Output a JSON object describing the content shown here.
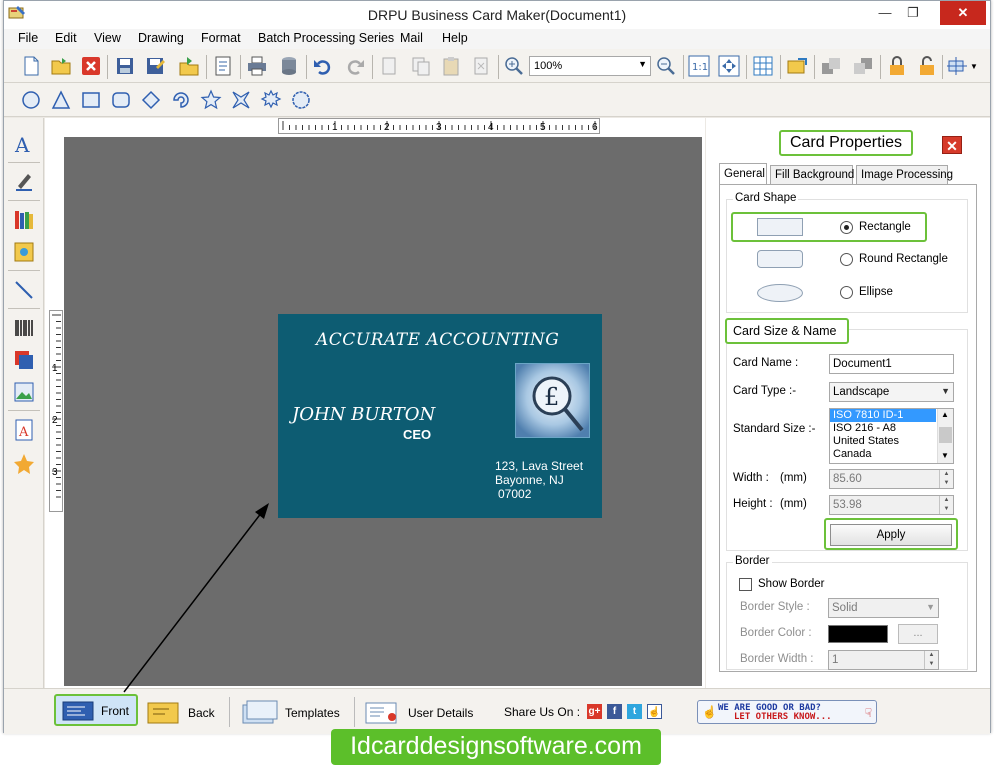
{
  "window": {
    "title": "DRPU Business Card Maker(Document1)"
  },
  "menu": [
    "File",
    "Edit",
    "View",
    "Drawing",
    "Format",
    "Batch Processing Series",
    "Mail",
    "Help"
  ],
  "toolbar": {
    "zoom_value": "100%"
  },
  "ruler": {
    "h_labels": [
      "1",
      "2",
      "3",
      "4",
      "5",
      "6"
    ],
    "v_labels": [
      "1",
      "2",
      "3"
    ]
  },
  "card": {
    "company": "ACCURATE ACCOUNTING",
    "name": "JOHN BURTON",
    "title": "CEO",
    "logo_symbol": "£",
    "address": [
      "123, Lava Street",
      "Bayonne, NJ",
      "07002"
    ],
    "background_color": "#0d5c72"
  },
  "properties": {
    "title": "Card Properties",
    "tabs": [
      "General",
      "Fill Background",
      "Image Processing"
    ],
    "card_shape": {
      "label": "Card Shape",
      "options": [
        "Rectangle",
        "Round Rectangle",
        "Ellipse"
      ],
      "selected": "Rectangle"
    },
    "card_size": {
      "label": "Card Size & Name",
      "card_name_label": "Card Name :",
      "card_name_value": "Document1",
      "card_type_label": "Card Type :-",
      "card_type_value": "Landscape",
      "standard_size_label": "Standard Size :-",
      "standard_sizes": [
        "ISO 7810 ID-1",
        "ISO 216 - A8",
        "United States",
        "Canada"
      ],
      "selected_size": "ISO 7810 ID-1",
      "width_label": "Width :",
      "height_label": "Height :",
      "unit": "(mm)",
      "width_value": "85.60",
      "height_value": "53.98",
      "apply_label": "Apply"
    },
    "border": {
      "label": "Border",
      "show_border_label": "Show Border",
      "style_label": "Border Style :",
      "style_value": "Solid",
      "color_label": "Border Color :",
      "color_value": "#000000",
      "color_button": "...",
      "width_label": "Border Width :",
      "width_value": "1"
    }
  },
  "bottombar": {
    "front": "Front",
    "back": "Back",
    "templates": "Templates",
    "user_details": "User Details",
    "share_label": "Share Us On :",
    "feedback_line1": "WE ARE GOOD OR BAD?",
    "feedback_line2": "LET OTHERS KNOW..."
  },
  "banner": {
    "text": "Idcarddesignsoftware.com"
  },
  "colors": {
    "accent": "#6cc13a",
    "close_red": "#c7281d"
  }
}
